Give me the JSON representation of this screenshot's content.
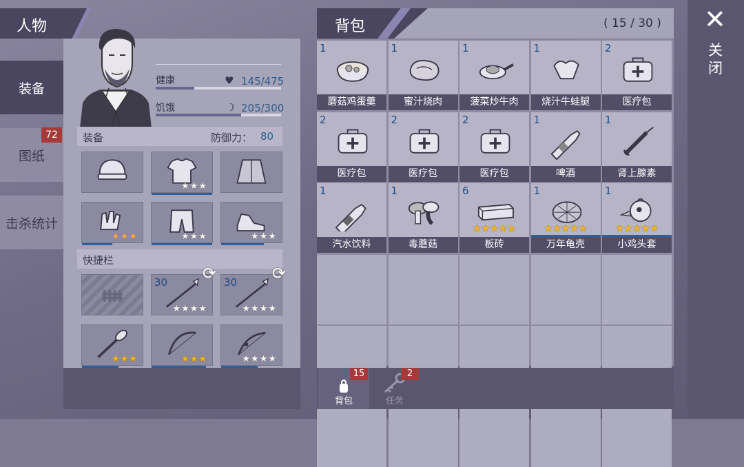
{
  "character": {
    "title": "人物"
  },
  "tabs": [
    {
      "label": "装备",
      "active": true
    },
    {
      "label": "图纸",
      "badge": "72"
    },
    {
      "label": "击杀统计"
    }
  ],
  "stats": {
    "health": {
      "label": "健康",
      "value": "145/475",
      "fraction": 0.31
    },
    "hunger": {
      "label": "饥饿",
      "value": "205/300",
      "fraction": 0.68
    }
  },
  "equipment": {
    "title": "装备",
    "defense_label": "防御力：",
    "defense_value": "80"
  },
  "quickbar": {
    "title": "快捷栏"
  },
  "equip_slots": [
    {
      "icon": "beanie-icon",
      "stars": 0
    },
    {
      "icon": "tshirt-icon",
      "stars": 3,
      "star_color": "white",
      "durability": 1.0
    },
    {
      "icon": "jacket-icon",
      "stars": 0
    },
    {
      "icon": "gloves-icon",
      "stars": 3,
      "star_color": "gold",
      "durability": 0.5
    },
    {
      "icon": "shorts-icon",
      "stars": 3,
      "star_color": "white",
      "durability": 1.0
    },
    {
      "icon": "sneakers-icon",
      "stars": 3,
      "star_color": "white",
      "durability": 0.7
    }
  ],
  "quick_slots": [
    {
      "icon": "locked-slot-icon",
      "stars": 0
    },
    {
      "icon": "fire-spear-icon",
      "count": "30",
      "stars": 4,
      "star_color": "white",
      "swap": true
    },
    {
      "icon": "poison-spear-icon",
      "count": "30",
      "stars": 4,
      "star_color": "white",
      "swap": true
    },
    {
      "icon": "spiked-club-icon",
      "stars": 3,
      "star_color": "gold",
      "durability": 0.6
    },
    {
      "icon": "bow-icon",
      "stars": 3,
      "star_color": "gold",
      "durability": 0.9
    },
    {
      "icon": "compound-bow-icon",
      "stars": 4,
      "star_color": "white",
      "durability": 0.6
    }
  ],
  "bag": {
    "title": "背包",
    "count": "( 15 / 30 )"
  },
  "bag_items": [
    {
      "name": "蘑菇鸡蛋羹",
      "count": "1",
      "icon": "mushroom-egg-bowl-icon"
    },
    {
      "name": "蜜汁烧肉",
      "count": "1",
      "icon": "roast-meat-icon"
    },
    {
      "name": "菠菜炒牛肉",
      "count": "1",
      "icon": "frying-pan-icon"
    },
    {
      "name": "烧汁牛蛙腿",
      "count": "1",
      "icon": "frog-legs-icon"
    },
    {
      "name": "医疗包",
      "count": "2",
      "icon": "medkit-icon"
    },
    {
      "name": "医疗包",
      "count": "2",
      "icon": "medkit-icon"
    },
    {
      "name": "医疗包",
      "count": "2",
      "icon": "medkit-icon"
    },
    {
      "name": "医疗包",
      "count": "2",
      "icon": "medkit-icon"
    },
    {
      "name": "啤酒",
      "count": "1",
      "icon": "beer-bottle-icon"
    },
    {
      "name": "肾上腺素",
      "count": "1",
      "icon": "syringe-icon"
    },
    {
      "name": "汽水饮料",
      "count": "1",
      "icon": "soda-bottle-icon"
    },
    {
      "name": "毒蘑菇",
      "count": "1",
      "icon": "poison-mushroom-icon"
    },
    {
      "name": "板砖",
      "count": "6",
      "icon": "brick-icon",
      "stars": 5
    },
    {
      "name": "万年龟壳",
      "count": "1",
      "icon": "turtle-shell-icon",
      "stars": 5,
      "durability": 1.0
    },
    {
      "name": "小鸡头套",
      "count": "1",
      "icon": "chicken-mask-icon",
      "stars": 5,
      "durability": 1.0
    }
  ],
  "bottom_tabs": [
    {
      "label": "背包",
      "badge": "15",
      "icon": "backpack-icon"
    },
    {
      "label": "任务",
      "badge": "2",
      "icon": "key-icon"
    }
  ],
  "close": {
    "label": "关闭"
  }
}
